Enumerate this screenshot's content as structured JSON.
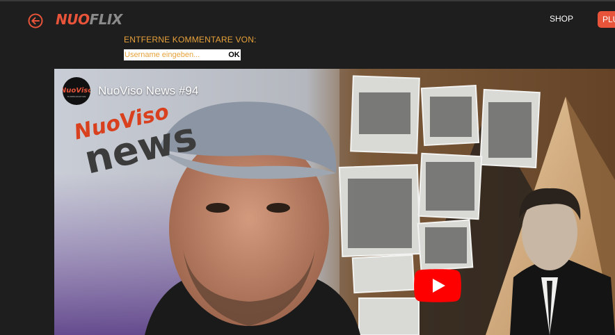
{
  "header": {
    "logo_part1": "NUO",
    "logo_part2": "FLIX",
    "shop_label": "SHOP",
    "plus_label": "PLU"
  },
  "comments_filter": {
    "label": "ENTFERNE KOMMENTARE VON:",
    "placeholder": "Username eingeben...",
    "value": "",
    "ok_label": "OK"
  },
  "video": {
    "title": "NuoViso News #94",
    "channel_avatar_text": "NuoViso",
    "channel_avatar_subtext": "FILMPRODUKTION",
    "thumbnail_logo_top": "NuoViso",
    "thumbnail_logo_bottom": "news"
  },
  "colors": {
    "accent": "#e8543a",
    "label": "#e8a23a",
    "background": "#1e1e1e",
    "play_button": "#ff0000"
  }
}
